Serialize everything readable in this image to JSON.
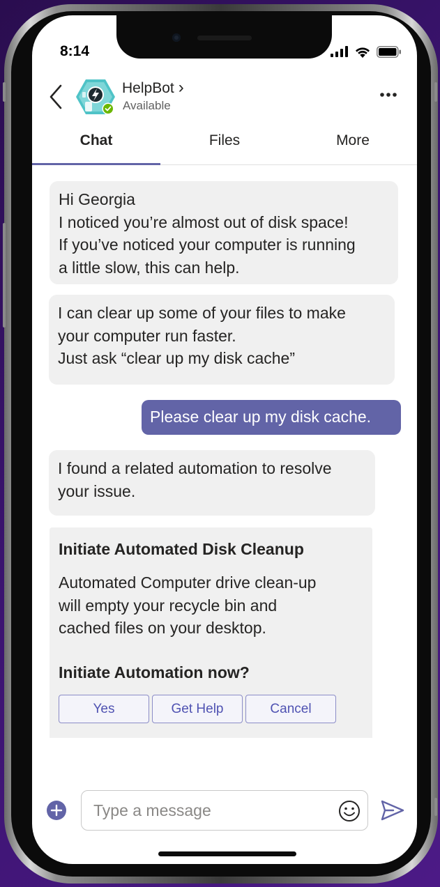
{
  "status_bar": {
    "time": "8:14"
  },
  "header": {
    "name": "HelpBot",
    "chevron": "›",
    "status": "Available",
    "status_color": "#6bb700",
    "accent": "#6264a7"
  },
  "tabs": [
    {
      "label": "Chat",
      "active": true
    },
    {
      "label": "Files",
      "active": false
    },
    {
      "label": "More",
      "active": false
    }
  ],
  "messages": [
    {
      "from": "bot",
      "text": "Hi Georgia\nI noticed you’re almost out of disk space!\nIf you’ve noticed your computer is running\na little slow, this can help."
    },
    {
      "from": "bot",
      "text": "I can clear up some of your files to make\nyour computer run faster.\nJust ask “clear up my disk cache”"
    },
    {
      "from": "user",
      "text": "Please clear up my disk cache."
    },
    {
      "from": "bot",
      "text": "I found a related automation to resolve\nyour issue."
    }
  ],
  "card": {
    "title": "Initiate Automated Disk Cleanup",
    "body": "Automated Computer drive clean-up\nwill empty your recycle bin and\ncached files on your desktop.",
    "question": "Initiate Automation now?",
    "buttons": [
      "Yes",
      "Get Help",
      "Cancel"
    ]
  },
  "compose": {
    "placeholder": "Type a message"
  }
}
